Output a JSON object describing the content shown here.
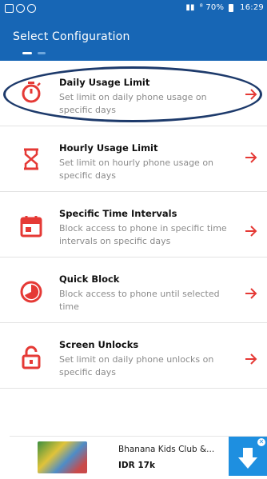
{
  "status_bar": {
    "right_text": "⁸ 70%",
    "time": "16:29"
  },
  "app_bar": {
    "title": "Select Configuration"
  },
  "items": [
    {
      "title": "Daily Usage Limit",
      "desc": "Set limit on daily phone usage on specific days",
      "icon": "stopwatch-icon"
    },
    {
      "title": "Hourly Usage Limit",
      "desc": "Set limit on hourly phone usage on specific days",
      "icon": "hourglass-icon"
    },
    {
      "title": "Specific Time Intervals",
      "desc": "Block access to phone in specific time intervals on specific days",
      "icon": "calendar-icon"
    },
    {
      "title": "Quick Block",
      "desc": "Block access to phone until selected time",
      "icon": "pie-clock-icon"
    },
    {
      "title": "Screen Unlocks",
      "desc": "Set limit on daily phone unlocks on specific days",
      "icon": "lock-icon"
    }
  ],
  "ad": {
    "title": "Bhanana Kids Club &...",
    "price": "IDR 17k"
  },
  "colors": {
    "primary": "#1766b5",
    "accent": "#e53935"
  }
}
